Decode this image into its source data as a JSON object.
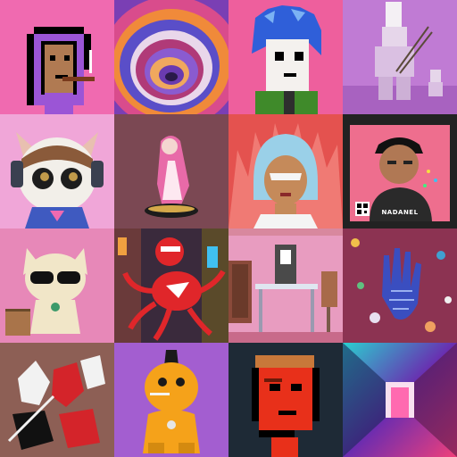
{
  "grid": {
    "tiles": [
      {
        "id": "t1",
        "subject": "pixel-punk-purple-hood-pipe",
        "bg": "#f06ab0"
      },
      {
        "id": "t2",
        "subject": "psychedelic-swirl",
        "bg": "#7a3fb4"
      },
      {
        "id": "t3",
        "subject": "pixel-blue-hair-character",
        "bg": "#ee5f9d"
      },
      {
        "id": "t4",
        "subject": "lego-figure-with-arrows",
        "bg": "#c07bd4"
      },
      {
        "id": "t5",
        "subject": "cat-with-headset",
        "bg": "#f0a6d8"
      },
      {
        "id": "t6",
        "subject": "pink-hair-figurine",
        "bg": "#8f5560"
      },
      {
        "id": "t7",
        "subject": "blue-hair-woman-flames",
        "bg": "#e4524f"
      },
      {
        "id": "t8",
        "subject": "man-with-cap-qr",
        "bg": "#ee6e8e",
        "caption": "NADANEL"
      },
      {
        "id": "t9",
        "subject": "cat-with-sunglasses",
        "bg": "#e788b8"
      },
      {
        "id": "t10",
        "subject": "red-octopus-city",
        "bg": "#3a2a3c"
      },
      {
        "id": "t11",
        "subject": "desk-room-interior",
        "bg": "#e89cc0"
      },
      {
        "id": "t12",
        "subject": "patterned-hand",
        "bg": "#8c3352"
      },
      {
        "id": "t13",
        "subject": "abstract-red-figures",
        "bg": "#bb7b6c"
      },
      {
        "id": "t14",
        "subject": "orange-character-smoking",
        "bg": "#a35ed0"
      },
      {
        "id": "t15",
        "subject": "pixel-red-punk",
        "bg": "#1e2a36"
      },
      {
        "id": "t16",
        "subject": "neon-corridor",
        "bg": "#3a2c5c"
      }
    ]
  }
}
